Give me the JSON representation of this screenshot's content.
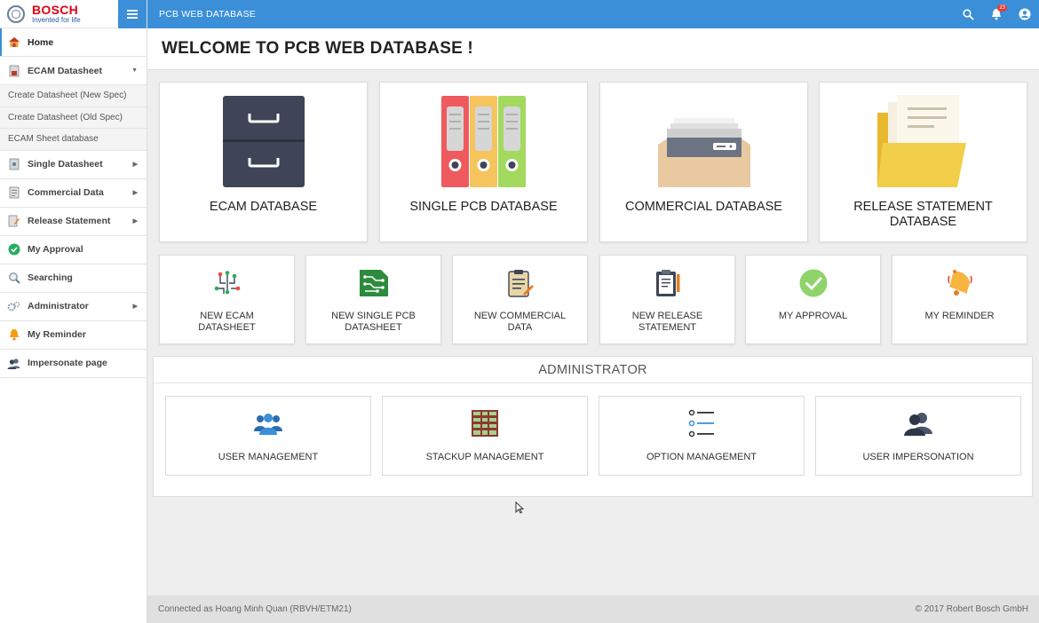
{
  "brand": {
    "name": "BOSCH",
    "tagline": "Invented for life"
  },
  "header": {
    "title": "PCB WEB DATABASE",
    "notification_count": "23"
  },
  "page": {
    "title": "WELCOME TO PCB WEB DATABASE !"
  },
  "sidebar": {
    "items": [
      {
        "label": "Home"
      },
      {
        "label": "ECAM Datasheet"
      },
      {
        "label": "Create Datasheet (New Spec)"
      },
      {
        "label": "Create Datasheet (Old Spec)"
      },
      {
        "label": "ECAM Sheet database"
      },
      {
        "label": "Single Datasheet"
      },
      {
        "label": "Commercial Data"
      },
      {
        "label": "Release Statement"
      },
      {
        "label": "My Approval"
      },
      {
        "label": "Searching"
      },
      {
        "label": "Administrator"
      },
      {
        "label": "My Reminder"
      },
      {
        "label": "Impersonate page"
      }
    ]
  },
  "databases": [
    {
      "label": "ECAM DATABASE"
    },
    {
      "label": "SINGLE PCB DATABASE"
    },
    {
      "label": "COMMERCIAL DATABASE"
    },
    {
      "label": "RELEASE STATEMENT DATABASE"
    }
  ],
  "actions": [
    {
      "label": "NEW ECAM DATASHEET"
    },
    {
      "label": "NEW SINGLE PCB DATASHEET"
    },
    {
      "label": "NEW COMMERCIAL DATA"
    },
    {
      "label": "NEW RELEASE STATEMENT"
    },
    {
      "label": "MY APPROVAL"
    },
    {
      "label": "MY REMINDER"
    }
  ],
  "admin": {
    "title": "ADMINISTRATOR",
    "items": [
      {
        "label": "USER MANAGEMENT"
      },
      {
        "label": "STACKUP MANAGEMENT"
      },
      {
        "label": "OPTION MANAGEMENT"
      },
      {
        "label": "USER IMPERSONATION"
      }
    ]
  },
  "footer": {
    "left": "Connected as Hoang Minh Quan (RBVH/ETM21)",
    "right": "© 2017 Robert Bosch GmbH"
  },
  "colors": {
    "primary": "#3a8fd8",
    "brand_red": "#e20015",
    "approval_green": "#8ed46a"
  }
}
